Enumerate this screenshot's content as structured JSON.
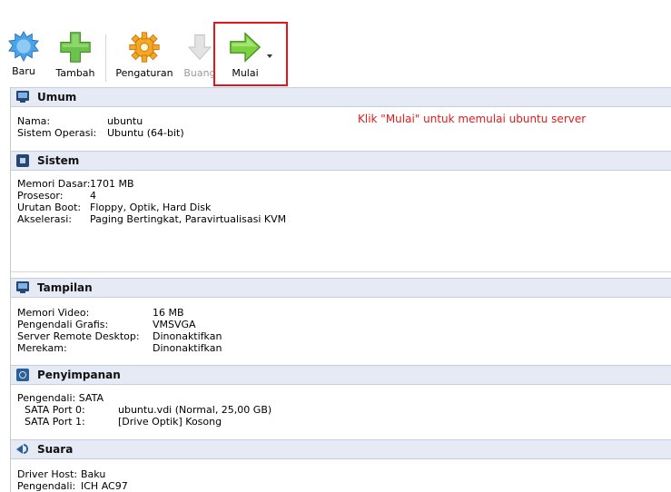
{
  "toolbar": {
    "new_label": "Baru",
    "add_label": "Tambah",
    "settings_label": "Pengaturan",
    "discard_label": "Buang",
    "start_label": "Mulai"
  },
  "annotation": "Klik \"Mulai\" untuk memulai ubuntu server",
  "sections": {
    "general": {
      "title": "Umum",
      "name_key": "Nama:",
      "name_val": "ubuntu",
      "os_key": "Sistem Operasi:",
      "os_val": "Ubuntu (64-bit)"
    },
    "system": {
      "title": "Sistem",
      "mem_key": "Memori Dasar:",
      "mem_val": "1701 MB",
      "cpu_key": "Prosesor:",
      "cpu_val": "4",
      "boot_key": "Urutan Boot:",
      "boot_val": "Floppy, Optik, Hard Disk",
      "accel_key": "Akselerasi:",
      "accel_val": "Paging Bertingkat, Paravirtualisasi KVM"
    },
    "display": {
      "title": "Tampilan",
      "vmem_key": "Memori Video:",
      "vmem_val": "16 MB",
      "gc_key": "Pengendali Grafis:",
      "gc_val": "VMSVGA",
      "rds_key": "Server Remote Desktop:",
      "rds_val": "Dinonaktifkan",
      "rec_key": "Merekam:",
      "rec_val": "Dinonaktifkan"
    },
    "storage": {
      "title": "Penyimpanan",
      "ctrl": "Pengendali: SATA",
      "p0_key": "SATA Port 0:",
      "p0_val": "ubuntu.vdi (Normal, 25,00 GB)",
      "p1_key": "SATA Port 1:",
      "p1_val": "[Drive Optik] Kosong"
    },
    "audio": {
      "title": "Suara",
      "host_key": "Driver Host:",
      "host_val": "Baku",
      "ctrl_key": "Pengendali:",
      "ctrl_val": "ICH AC97"
    }
  },
  "icons": {
    "new": "starburst-new-icon",
    "add": "green-plus-icon",
    "settings": "gear-icon",
    "discard": "down-arrow-icon",
    "start": "green-right-arrow-icon"
  },
  "colors": {
    "highlight": "#e0161b",
    "annotation": "#e01b1b",
    "section_header_bg": "#e5eaf4"
  }
}
